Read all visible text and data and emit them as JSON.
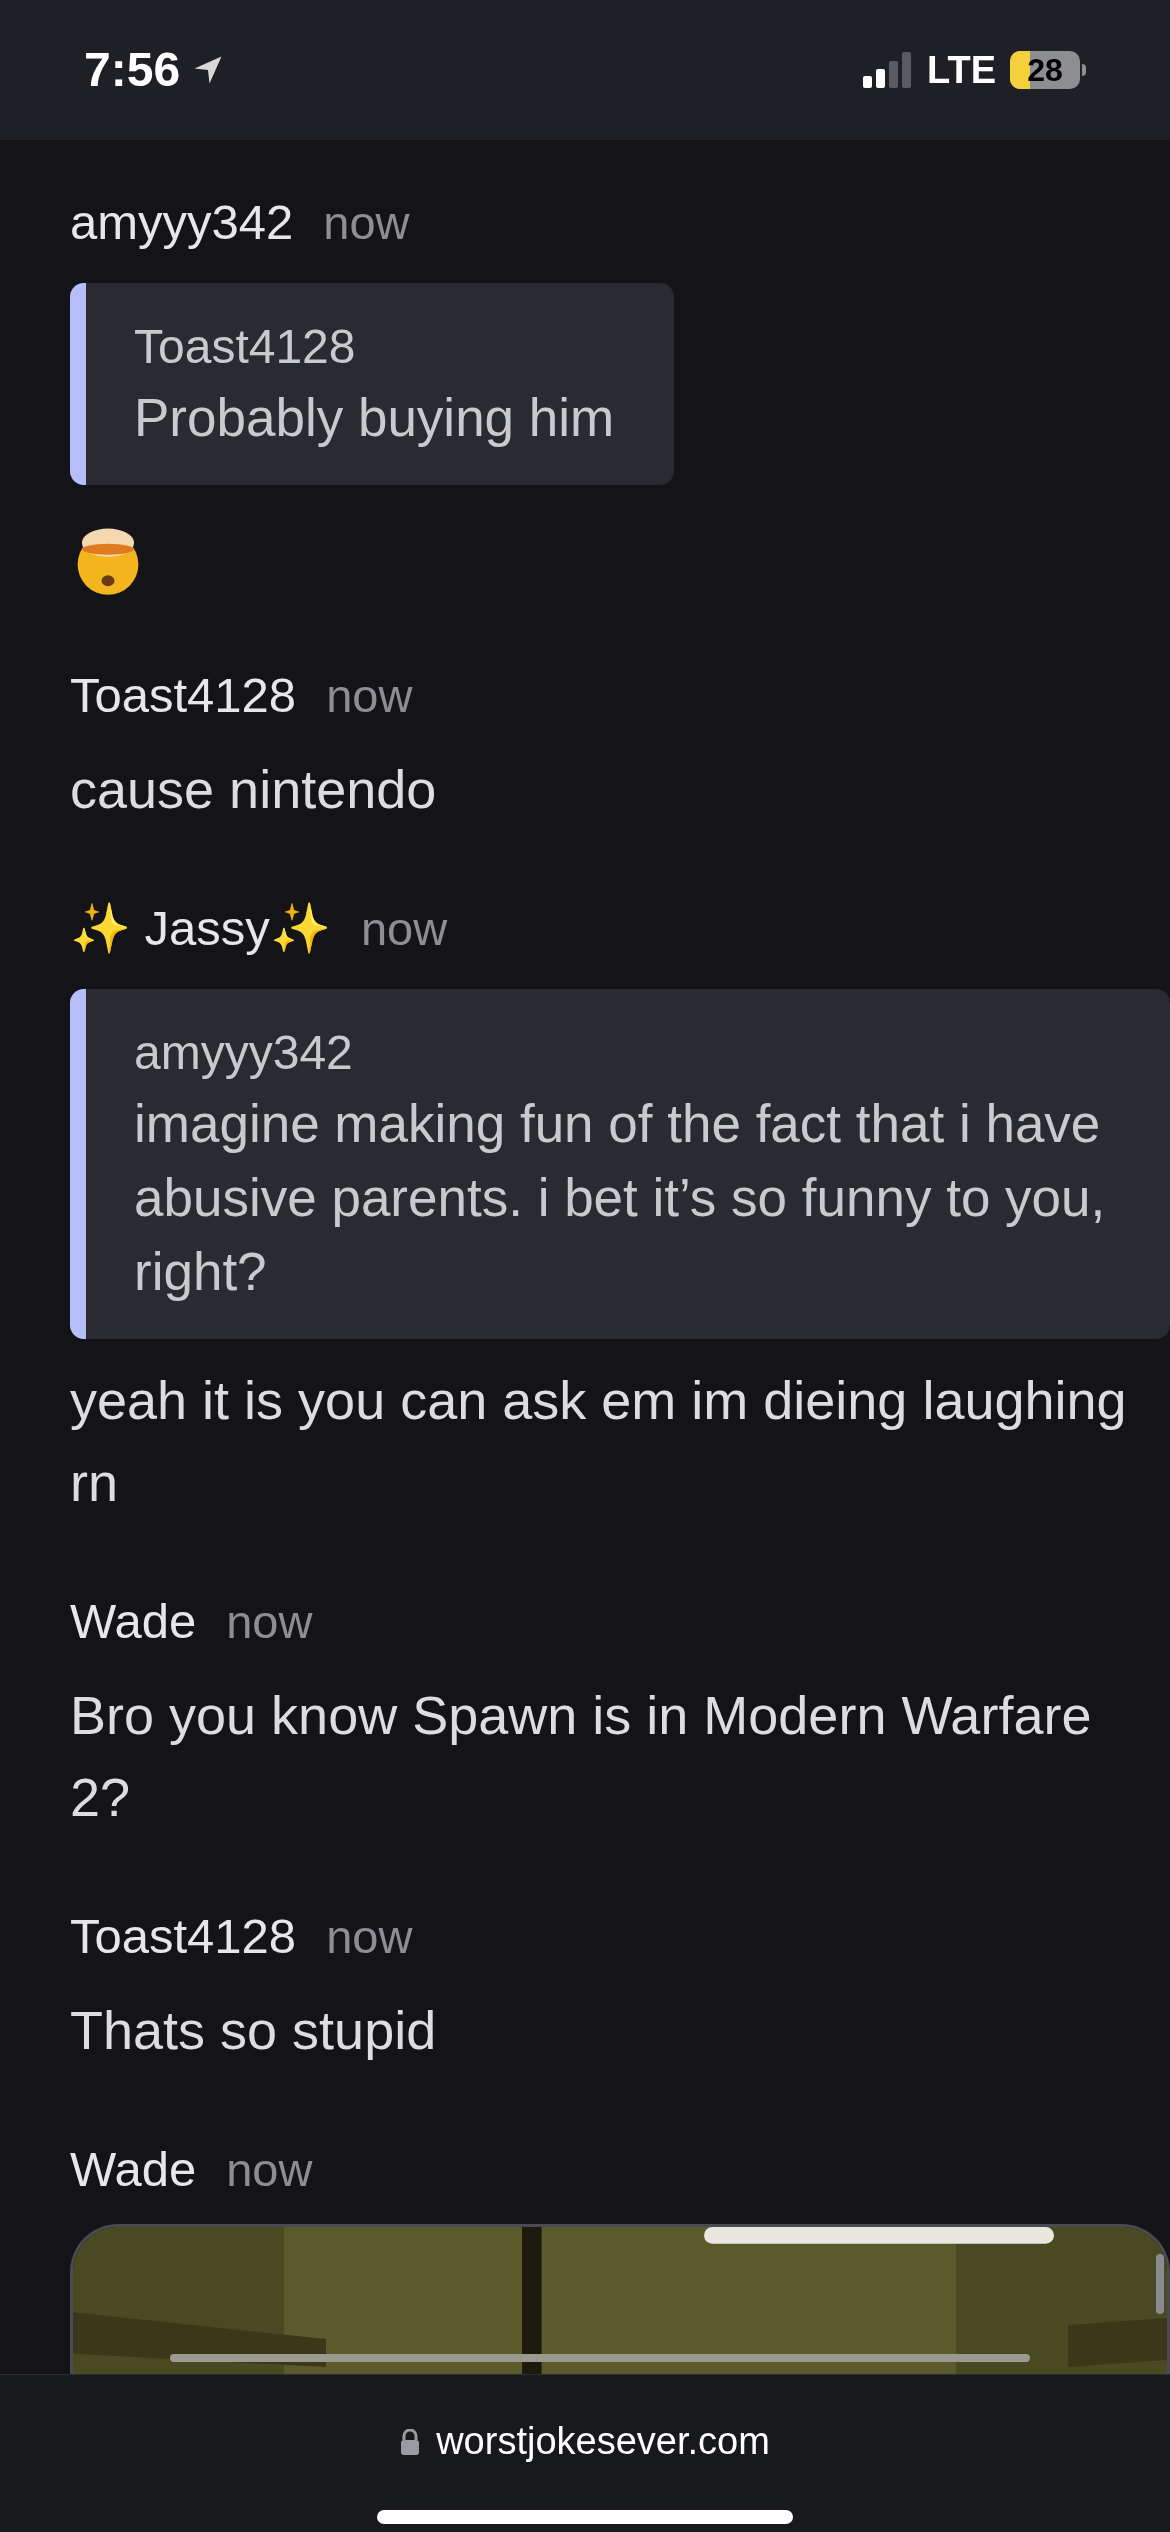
{
  "status_bar": {
    "time": "7:56",
    "network": "LTE",
    "battery": "28"
  },
  "messages": [
    {
      "author": "amyyy342",
      "time": "now",
      "quote": {
        "author": "Toast4128",
        "text": "Probably buying him"
      },
      "body": {
        "kind": "emoji"
      }
    },
    {
      "author": "Toast4128",
      "time": "now",
      "body": {
        "kind": "text",
        "text": "cause nintendo"
      }
    },
    {
      "author": "✨ Jassy✨",
      "time": "now",
      "quote": {
        "author": "amyyy342",
        "text": "imagine making fun of the fact that i have abusive parents. i bet it’s so funny to you, right?"
      },
      "body": {
        "kind": "text",
        "text": "yeah it is you can ask em im dieing laughing rn"
      }
    },
    {
      "author": "Wade",
      "time": "now",
      "body": {
        "kind": "text",
        "text": "Bro you know Spawn is in Modern Warfare 2?"
      }
    },
    {
      "author": "Toast4128",
      "time": "now",
      "body": {
        "kind": "text",
        "text": "Thats so stupid"
      }
    },
    {
      "author": "Wade",
      "time": "now"
    }
  ],
  "address_bar": {
    "url": "worstjokesever.com"
  }
}
